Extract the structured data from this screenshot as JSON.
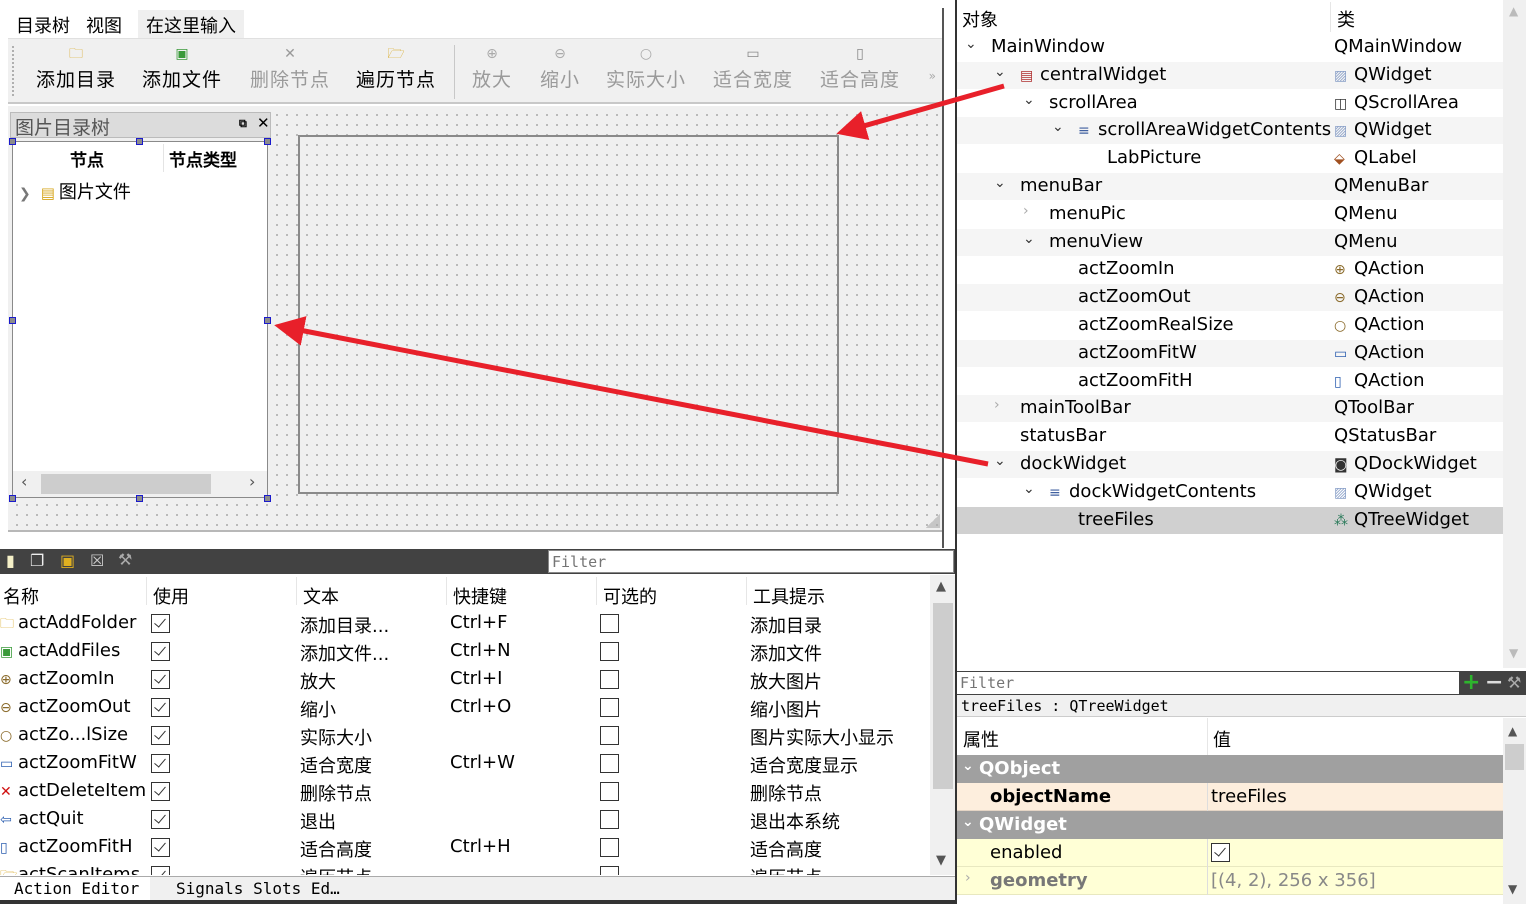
{
  "form": {
    "menubar": [
      "目录树",
      "视图"
    ],
    "menu_input_placeholder": "在这里输入",
    "toolbar": [
      {
        "label": "添加目录",
        "icon": "folder-icon",
        "enabled": true
      },
      {
        "label": "添加文件",
        "icon": "image-file-icon",
        "enabled": true
      },
      {
        "label": "删除节点",
        "icon": "delete-icon",
        "enabled": false
      },
      {
        "label": "遍历节点",
        "icon": "scan-folder-icon",
        "enabled": true
      },
      {
        "label": "放大",
        "icon": "zoom-in-icon",
        "enabled": false
      },
      {
        "label": "缩小",
        "icon": "zoom-out-icon",
        "enabled": false
      },
      {
        "label": "实际大小",
        "icon": "zoom-real-icon",
        "enabled": false
      },
      {
        "label": "适合宽度",
        "icon": "fit-width-icon",
        "enabled": false
      },
      {
        "label": "适合高度",
        "icon": "fit-height-icon",
        "enabled": false
      }
    ],
    "toolbar_extension": "»",
    "dock": {
      "title": "图片目录树",
      "tree_headers": [
        "节点",
        "节点类型"
      ],
      "tree_items": [
        {
          "label": "图片文件",
          "icon": "picture-folder-icon"
        }
      ]
    }
  },
  "action_editor": {
    "filter_placeholder": "Filter",
    "columns": [
      "名称",
      "使用",
      "文本",
      "快捷键",
      "可选的",
      "工具提示"
    ],
    "rows": [
      {
        "name": "actAddFolder",
        "icon": "folder-icon",
        "used": true,
        "text": "添加目录...",
        "shortcut": "Ctrl+F",
        "checkable": false,
        "tooltip": "添加目录"
      },
      {
        "name": "actAddFiles",
        "icon": "image-file-icon",
        "used": true,
        "text": "添加文件...",
        "shortcut": "Ctrl+N",
        "checkable": false,
        "tooltip": "添加文件"
      },
      {
        "name": "actZoomIn",
        "icon": "zoom-in-icon",
        "used": true,
        "text": "放大",
        "shortcut": "Ctrl+I",
        "checkable": false,
        "tooltip": "放大图片"
      },
      {
        "name": "actZoomOut",
        "icon": "zoom-out-icon",
        "used": true,
        "text": "缩小",
        "shortcut": "Ctrl+O",
        "checkable": false,
        "tooltip": "缩小图片"
      },
      {
        "name": "actZo...lSize",
        "icon": "zoom-real-icon",
        "used": true,
        "text": "实际大小",
        "shortcut": "",
        "checkable": false,
        "tooltip": "图片实际大小显示"
      },
      {
        "name": "actZoomFitW",
        "icon": "fit-width-icon",
        "used": true,
        "text": "适合宽度",
        "shortcut": "Ctrl+W",
        "checkable": false,
        "tooltip": "适合宽度显示"
      },
      {
        "name": "actDeleteItem",
        "icon": "delete-icon",
        "used": true,
        "text": "删除节点",
        "shortcut": "",
        "checkable": false,
        "tooltip": "删除节点"
      },
      {
        "name": "actQuit",
        "icon": "quit-icon",
        "used": true,
        "text": "退出",
        "shortcut": "",
        "checkable": false,
        "tooltip": "退出本系统"
      },
      {
        "name": "actZoomFitH",
        "icon": "fit-height-icon",
        "used": true,
        "text": "适合高度",
        "shortcut": "Ctrl+H",
        "checkable": false,
        "tooltip": "适合高度"
      },
      {
        "name": "actScanItems",
        "icon": "scan-folder-icon",
        "used": true,
        "text": "遍历节点",
        "shortcut": "",
        "checkable": false,
        "tooltip": "遍历节点"
      }
    ],
    "tabs": [
      "Action Editor",
      "Signals  Slots Ed…"
    ]
  },
  "object_inspector": {
    "headers": [
      "对象",
      "类"
    ],
    "rows": [
      {
        "name": "MainWindow",
        "class": "QMainWindow",
        "depth": 0,
        "expand": "open",
        "icon": "",
        "class_icon": ""
      },
      {
        "name": "centralWidget",
        "class": "QWidget",
        "depth": 1,
        "expand": "open",
        "icon": "layout-broken-icon",
        "class_icon": "widget-icon"
      },
      {
        "name": "scrollArea",
        "class": "QScrollArea",
        "depth": 2,
        "expand": "open",
        "icon": "",
        "class_icon": "scrollarea-icon"
      },
      {
        "name": "scrollAreaWidgetContents",
        "class": "QWidget",
        "depth": 3,
        "expand": "open",
        "icon": "vlayout-icon",
        "class_icon": "widget-icon"
      },
      {
        "name": "LabPicture",
        "class": "QLabel",
        "depth": 4,
        "expand": "none",
        "icon": "",
        "class_icon": "label-icon"
      },
      {
        "name": "menuBar",
        "class": "QMenuBar",
        "depth": 1,
        "expand": "open",
        "icon": "",
        "class_icon": ""
      },
      {
        "name": "menuPic",
        "class": "QMenu",
        "depth": 2,
        "expand": "closed",
        "icon": "",
        "class_icon": ""
      },
      {
        "name": "menuView",
        "class": "QMenu",
        "depth": 2,
        "expand": "open",
        "icon": "",
        "class_icon": ""
      },
      {
        "name": "actZoomIn",
        "class": "QAction",
        "depth": 3,
        "expand": "none",
        "icon": "",
        "class_icon": "zoom-in-icon"
      },
      {
        "name": "actZoomOut",
        "class": "QAction",
        "depth": 3,
        "expand": "none",
        "icon": "",
        "class_icon": "zoom-out-icon"
      },
      {
        "name": "actZoomRealSize",
        "class": "QAction",
        "depth": 3,
        "expand": "none",
        "icon": "",
        "class_icon": "zoom-real-icon"
      },
      {
        "name": "actZoomFitW",
        "class": "QAction",
        "depth": 3,
        "expand": "none",
        "icon": "",
        "class_icon": "fit-width-icon"
      },
      {
        "name": "actZoomFitH",
        "class": "QAction",
        "depth": 3,
        "expand": "none",
        "icon": "",
        "class_icon": "fit-height-icon"
      },
      {
        "name": "mainToolBar",
        "class": "QToolBar",
        "depth": 1,
        "expand": "closed",
        "icon": "",
        "class_icon": ""
      },
      {
        "name": "statusBar",
        "class": "QStatusBar",
        "depth": 1,
        "expand": "none",
        "icon": "",
        "class_icon": ""
      },
      {
        "name": "dockWidget",
        "class": "QDockWidget",
        "depth": 1,
        "expand": "open",
        "icon": "",
        "class_icon": "dockwidget-icon"
      },
      {
        "name": "dockWidgetContents",
        "class": "QWidget",
        "depth": 2,
        "expand": "open",
        "icon": "vlayout-icon",
        "class_icon": "widget-icon"
      },
      {
        "name": "treeFiles",
        "class": "QTreeWidget",
        "depth": 3,
        "expand": "none",
        "icon": "",
        "class_icon": "treewidget-icon",
        "selected": true
      }
    ]
  },
  "property_editor": {
    "filter_placeholder": "Filter",
    "object_label": "treeFiles : QTreeWidget",
    "headers": [
      "属性",
      "值"
    ],
    "rows": [
      {
        "type": "group",
        "label": "QObject"
      },
      {
        "type": "obj",
        "label": "objectName",
        "value": "treeFiles",
        "bold": true
      },
      {
        "type": "group",
        "label": "QWidget"
      },
      {
        "type": "wid",
        "label": "enabled",
        "checkbox": true
      },
      {
        "type": "wid",
        "label": "geometry",
        "value": "[(4, 2), 256 x 356]",
        "expandable": true,
        "dim": true
      }
    ]
  },
  "colors": {
    "annotation_arrow": "#e8202a",
    "selection_handle": "#1a1acc",
    "group_header": "#a0a0a0",
    "qobject_row": "#fdeedd",
    "qwidget_row": "#ffffd6"
  }
}
